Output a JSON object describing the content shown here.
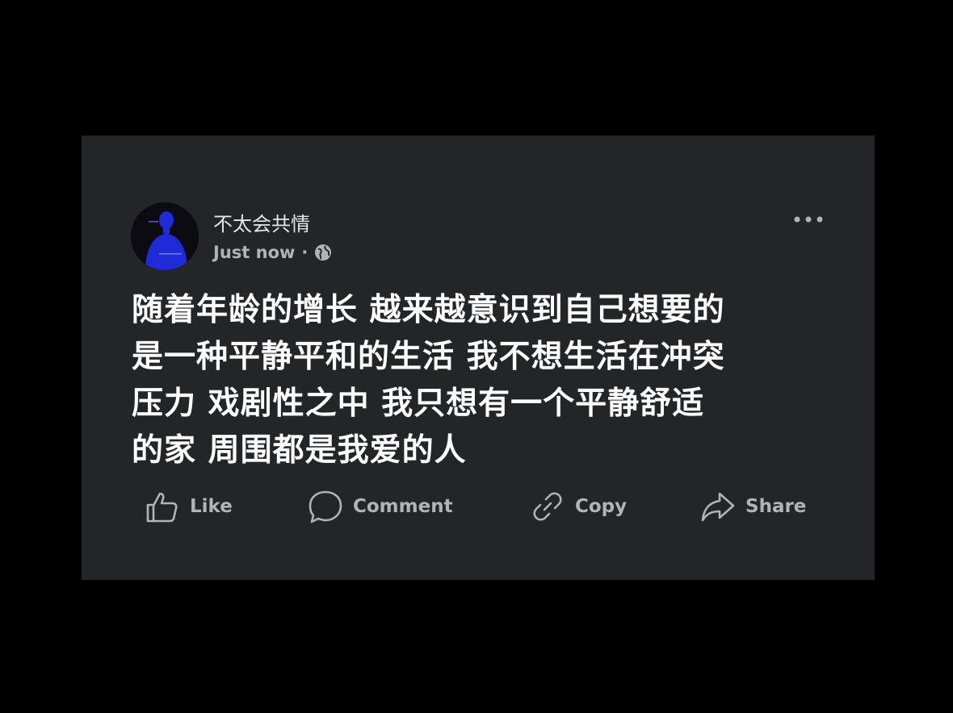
{
  "post": {
    "author_name": "不太会共情",
    "timestamp": "Just now",
    "separator": "·",
    "audience_icon": "globe-icon",
    "more_icon": "more-options-icon",
    "text_lines": [
      "随着年龄的增长 越来越意识到自己想要的",
      "是一种平静平和的生活 我不想生活在冲突",
      "压力 戏剧性之中 我只想有一个平静舒适",
      "的家 周围都是我爱的人"
    ]
  },
  "actions": {
    "like_label": "Like",
    "comment_label": "Comment",
    "copy_label": "Copy",
    "share_label": "Share"
  },
  "colors": {
    "page_background": "#000000",
    "card_background": "#242526",
    "primary_text": "#ffffff",
    "secondary_text": "#b0b3b8",
    "avatar_accent": "#1f2bd6"
  }
}
